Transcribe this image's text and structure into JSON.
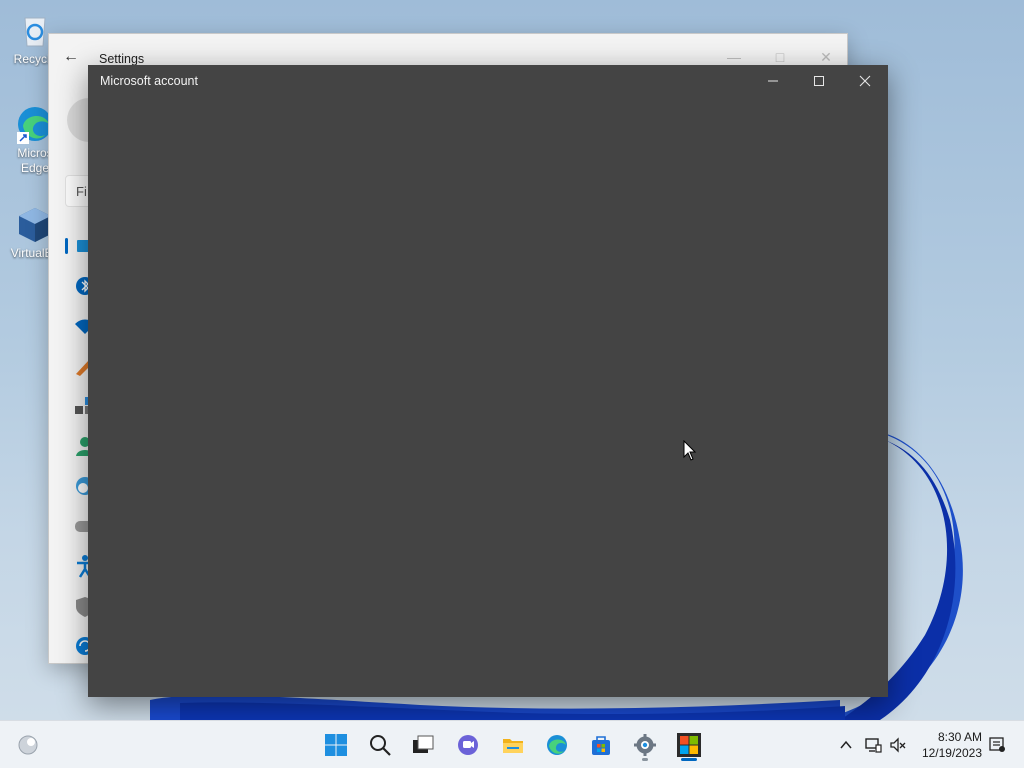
{
  "desktop": {
    "icons": [
      {
        "label": "Recycle",
        "icon": "recycle-bin-icon"
      },
      {
        "label": "Micros",
        "label2": "Edge",
        "icon": "edge-icon"
      },
      {
        "label": "VirtualBo",
        "icon": "virtualbox-icon"
      }
    ]
  },
  "settings_window": {
    "title": "Settings",
    "search_text": "Fi",
    "nav_icons": [
      "system-icon",
      "bluetooth-icon",
      "network-icon",
      "personalization-icon",
      "apps-icon",
      "accounts-icon",
      "time-language-icon",
      "gaming-icon",
      "accessibility-icon",
      "privacy-icon",
      "windows-update-icon"
    ]
  },
  "ms_account_window": {
    "title": "Microsoft account"
  },
  "taskbar": {
    "apps": [
      "start-icon",
      "search-icon",
      "task-view-icon",
      "chat-icon",
      "file-explorer-icon",
      "edge-icon",
      "store-icon",
      "settings-icon",
      "microsoft-account-icon"
    ],
    "time": "8:30 AM",
    "date": "12/19/2023"
  },
  "colors": {
    "accent": "#0067c0",
    "dialog_bg": "#444444",
    "taskbar_bg": "#eef2f6"
  }
}
